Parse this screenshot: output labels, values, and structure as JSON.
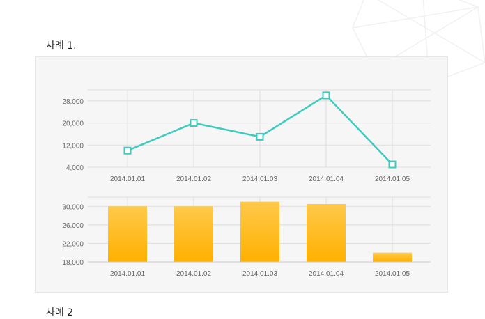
{
  "section1_title": "사례 1.",
  "section2_title": "사례 2",
  "colors": {
    "line": "#3ccbbd",
    "bar_top": "#ffc94a",
    "bar_bottom": "#ffb000",
    "grid": "#dddddd",
    "axis_text": "#666666"
  },
  "chart_data": [
    {
      "type": "line",
      "categories": [
        "2014.01.01",
        "2014.01.02",
        "2014.01.03",
        "2014.01.04",
        "2014.01.05"
      ],
      "values": [
        10000,
        20000,
        15000,
        30000,
        5000
      ],
      "yticks": [
        "4,000",
        "12,000",
        "20,000",
        "28,000"
      ],
      "ylim": [
        4000,
        32000
      ],
      "marker": "square-hollow",
      "grid": true
    },
    {
      "type": "bar",
      "categories": [
        "2014.01.01",
        "2014.01.02",
        "2014.01.03",
        "2014.01.04",
        "2014.01.05"
      ],
      "values": [
        30000,
        30000,
        31000,
        30500,
        20000
      ],
      "yticks": [
        "18,000",
        "22,000",
        "26,000",
        "30,000"
      ],
      "ylim": [
        18000,
        32000
      ],
      "grid": true
    }
  ]
}
